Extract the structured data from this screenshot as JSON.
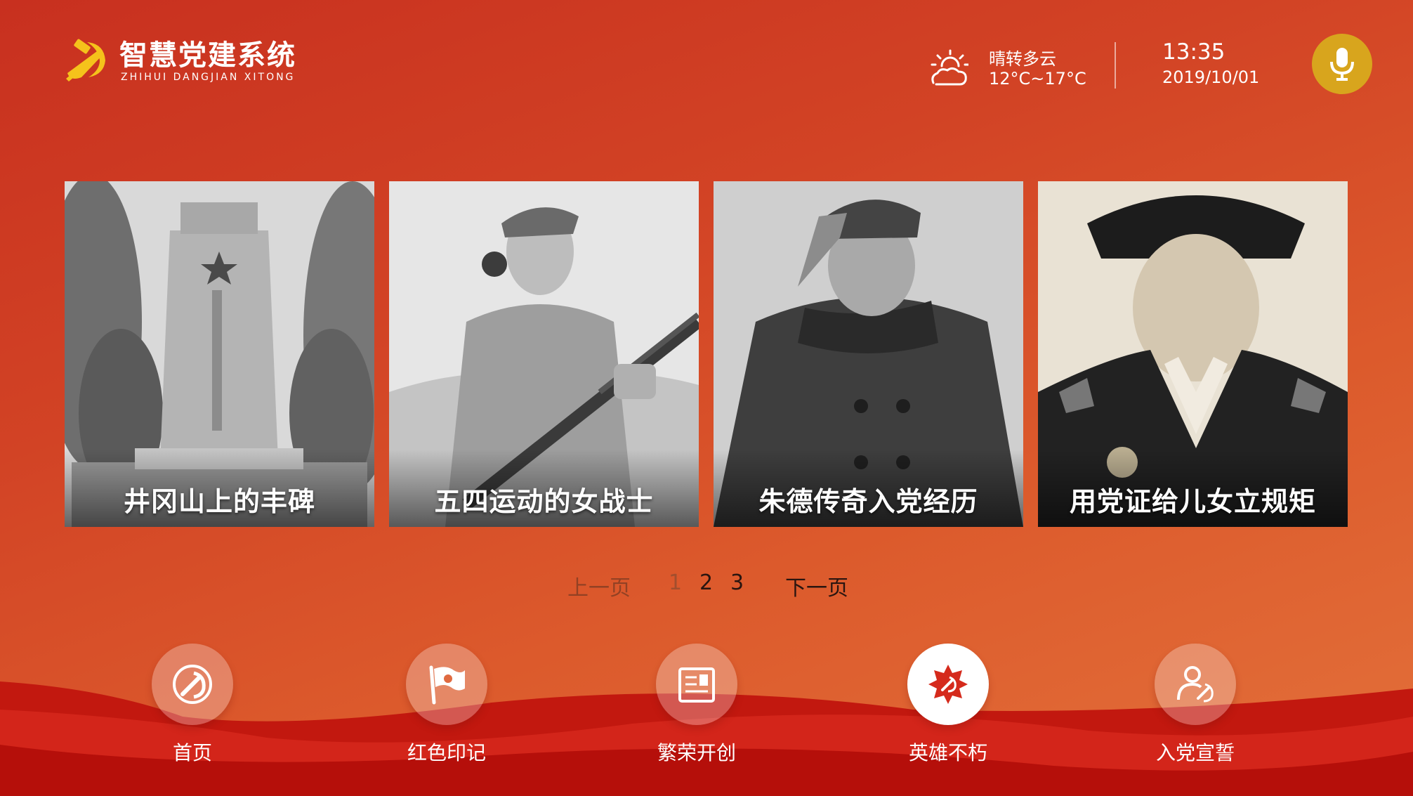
{
  "app": {
    "title": "智慧党建系统",
    "subtitle": "ZHIHUI DANGJIAN XITONG"
  },
  "header": {
    "weather": {
      "icon": "partly-cloudy-sun-icon",
      "condition": "晴转多云",
      "temperature": "12°C~17°C"
    },
    "clock": {
      "time": "13:35",
      "date": "2019/10/01"
    },
    "mic": {
      "icon": "microphone-icon"
    }
  },
  "cards": [
    {
      "caption": "井冈山上的丰碑"
    },
    {
      "caption": "五四运动的女战士"
    },
    {
      "caption": "朱德传奇入党经历"
    },
    {
      "caption": "用党证给儿女立规矩"
    }
  ],
  "pagination": {
    "prev_label": "上一页",
    "pages": [
      "1",
      "2",
      "3"
    ],
    "current_page": "1",
    "next_label": "下一页"
  },
  "nav": [
    {
      "label": "首页",
      "icon": "hammer-sickle-icon",
      "active": false
    },
    {
      "label": "红色印记",
      "icon": "party-flag-icon",
      "active": false
    },
    {
      "label": "繁荣开创",
      "icon": "newspaper-icon",
      "active": false
    },
    {
      "label": "英雄不朽",
      "icon": "star-badge-icon",
      "active": true
    },
    {
      "label": "入党宣誓",
      "icon": "member-person-icon",
      "active": false
    }
  ],
  "colors": {
    "background_top": "#c8301f",
    "background_bottom": "#e3703a",
    "mic_button": "#d8a51d",
    "emblem": "#f5c21b",
    "active_icon": "#d52a1c"
  }
}
